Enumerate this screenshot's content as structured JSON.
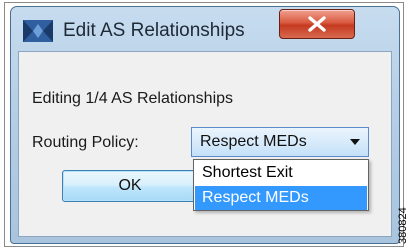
{
  "window": {
    "title": "Edit AS Relationships",
    "close_label": "X"
  },
  "dialog": {
    "editing_text": "Editing 1/4 AS Relationships",
    "routing_policy_label": "Routing Policy:",
    "routing_policy_value": "Respect MEDs",
    "ok_label": "OK"
  },
  "dropdown": {
    "options": [
      "Shortest Exit",
      "Respect MEDs"
    ],
    "highlighted": "Respect MEDs"
  },
  "figure_code": "380824",
  "colors": {
    "highlight": "#3399ff",
    "close_button": "#c43a20"
  }
}
